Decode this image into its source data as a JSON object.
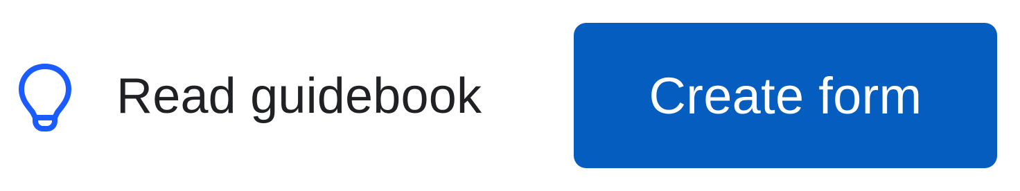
{
  "guide": {
    "icon": "lightbulb-icon",
    "label": "Read guidebook"
  },
  "create": {
    "label": "Create form"
  },
  "colors": {
    "accent": "#1a5cff",
    "button_bg": "#045dbf",
    "button_text": "#ffffff",
    "text": "#202124"
  }
}
